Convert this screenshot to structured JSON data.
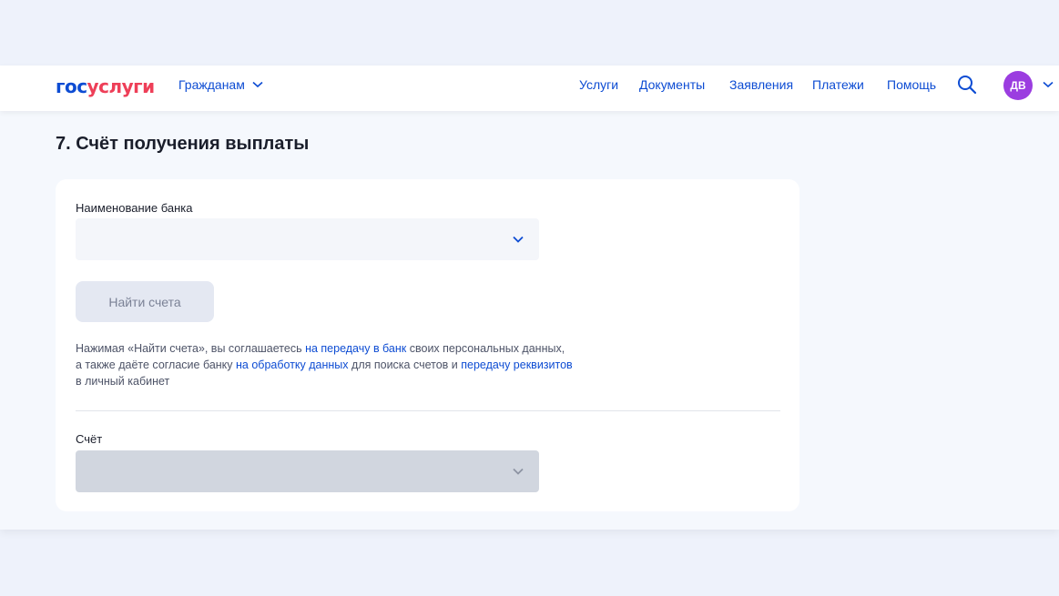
{
  "header": {
    "logo": {
      "gos": "гос",
      "uslugi": "услуги"
    },
    "citizens_label": "Гражданам",
    "nav": [
      "Услуги",
      "Документы",
      "Заявления",
      "Платежи",
      "Помощь"
    ],
    "avatar_initials": "ДВ",
    "colors": {
      "link": "#0d4cd3",
      "brand_red": "#ee3f58",
      "avatar": "#9b3de0"
    }
  },
  "page": {
    "title": "7. Счёт получения выплаты"
  },
  "form": {
    "bank_label": "Наименование банка",
    "bank_value": "",
    "find_button": "Найти счета",
    "consent": {
      "t1": "Нажимая «Найти счета», вы соглашаетесь ",
      "l1": "на передачу в банк",
      "t2": " своих персональных данных,",
      "t3": "а также даёте согласие банку ",
      "l2": "на обработку данных",
      "t4": " для поиска счетов и ",
      "l3": "передачу реквизитов",
      "t5": "в личный кабинет"
    },
    "account_label": "Счёт",
    "account_value": ""
  },
  "icons": {
    "search": "search-icon",
    "chevron": "chevron-down-icon"
  }
}
